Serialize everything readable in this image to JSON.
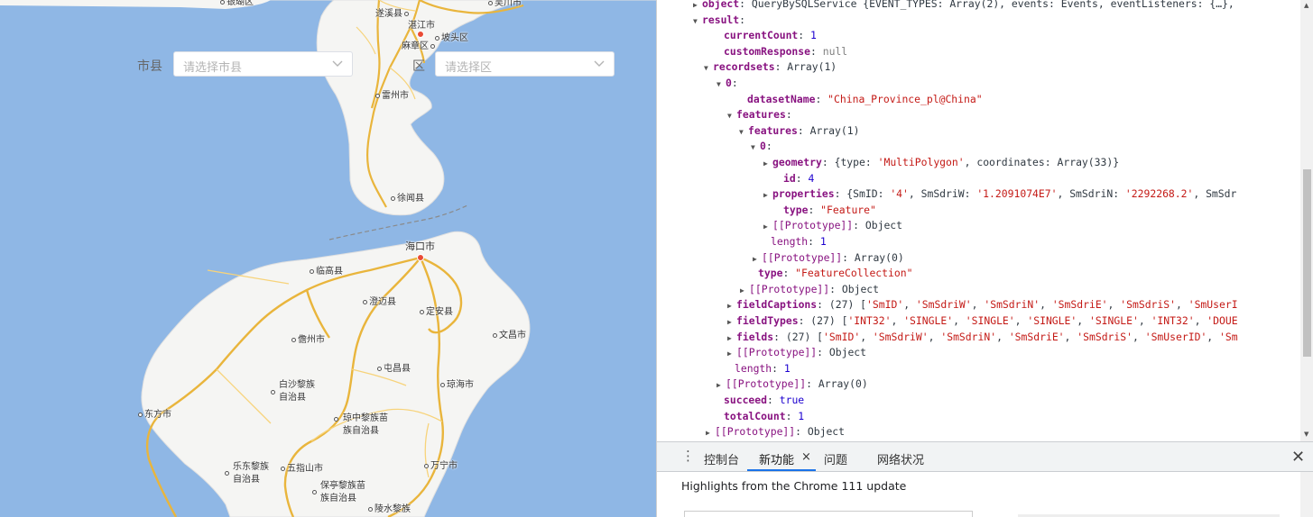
{
  "map": {
    "filters": {
      "city_label": "市县",
      "city_placeholder": "请选择市县",
      "district_label": "区",
      "district_placeholder": "请选择区"
    },
    "places": {
      "yinmu": "银瑚区",
      "suixi": "遂溪县",
      "wuchuan": "吴川市",
      "zhanjiang": "湛江市",
      "mazhang": "麻章区",
      "potou": "坡头区",
      "leizhou": "雷州市",
      "xuwen": "徐闻县",
      "haikou": "海口市",
      "lingao": "临高县",
      "chengmai": "澄迈县",
      "dingan": "定安县",
      "wenchang": "文昌市",
      "danzhou": "儋州市",
      "tunchang": "屯昌县",
      "baisha1": "白沙黎族",
      "baisha2": "自治县",
      "qionghai": "琼海市",
      "dongfang": "东方市",
      "qiongzhong1": "琼中黎族苗",
      "qiongzhong2": "族自治县",
      "ledong1": "乐东黎族",
      "ledong2": "自治县",
      "wuzhishan": "五指山市",
      "wanning": "万宁市",
      "baoting1": "保亭黎族苗",
      "baoting2": "族自治县",
      "lingshui": "陵水黎族"
    }
  },
  "console": {
    "lines": [
      {
        "tw": "▶",
        "parts": [
          [
            "k",
            "object"
          ],
          [
            "pl",
            ": QueryBySQLService {EVENT_TYPES: Array(2), events: Events, eventListeners: {…},"
          ]
        ]
      },
      {
        "tw": "▼",
        "parts": [
          [
            "k",
            "result"
          ],
          [
            "pl",
            ":"
          ]
        ]
      },
      {
        "tw": "",
        "parts": [
          [
            "k",
            "currentCount"
          ],
          [
            "pl",
            ": "
          ],
          [
            "n",
            "1"
          ]
        ]
      },
      {
        "tw": "",
        "parts": [
          [
            "k",
            "customResponse"
          ],
          [
            "pl",
            ": "
          ],
          [
            "nul",
            "null"
          ]
        ]
      },
      {
        "tw": "▼",
        "parts": [
          [
            "k",
            "recordsets"
          ],
          [
            "pl",
            ": Array(1)"
          ]
        ]
      },
      {
        "tw": "▼",
        "parts": [
          [
            "k",
            "0"
          ],
          [
            "pl",
            ":"
          ]
        ]
      },
      {
        "tw": "",
        "parts": [
          [
            "k",
            "datasetName"
          ],
          [
            "pl",
            ": "
          ],
          [
            "s",
            "\"China_Province_pl@China\""
          ]
        ]
      },
      {
        "tw": "▼",
        "parts": [
          [
            "k",
            "features"
          ],
          [
            "pl",
            ":"
          ]
        ]
      },
      {
        "tw": "▼",
        "parts": [
          [
            "k",
            "features"
          ],
          [
            "pl",
            ": Array(1)"
          ]
        ]
      },
      {
        "tw": "▼",
        "parts": [
          [
            "k",
            "0"
          ],
          [
            "pl",
            ":"
          ]
        ]
      },
      {
        "tw": "▶",
        "parts": [
          [
            "k",
            "geometry"
          ],
          [
            "pl",
            ": {type: "
          ],
          [
            "s",
            "'MultiPolygon'"
          ],
          [
            "pl",
            ", coordinates: Array(33)}"
          ]
        ]
      },
      {
        "tw": "",
        "parts": [
          [
            "k",
            "id"
          ],
          [
            "pl",
            ": "
          ],
          [
            "n",
            "4"
          ]
        ]
      },
      {
        "tw": "▶",
        "parts": [
          [
            "k",
            "properties"
          ],
          [
            "pl",
            ": {SmID: "
          ],
          [
            "s",
            "'4'"
          ],
          [
            "pl",
            ", SmSdriW: "
          ],
          [
            "s",
            "'1.2091074E7'"
          ],
          [
            "pl",
            ", SmSdriN: "
          ],
          [
            "s",
            "'2292268.2'"
          ],
          [
            "pl",
            ", SmSdr"
          ]
        ]
      },
      {
        "tw": "",
        "parts": [
          [
            "k",
            "type"
          ],
          [
            "pl",
            ": "
          ],
          [
            "s",
            "\"Feature\""
          ]
        ]
      },
      {
        "tw": "▶",
        "parts": [
          [
            "k2",
            "[[Prototype]]"
          ],
          [
            "pl",
            ": Object"
          ]
        ]
      },
      {
        "tw": "",
        "parts": [
          [
            "k2",
            "length"
          ],
          [
            "pl",
            ": "
          ],
          [
            "n",
            "1"
          ]
        ]
      },
      {
        "tw": "▶",
        "parts": [
          [
            "k2",
            "[[Prototype]]"
          ],
          [
            "pl",
            ": Array(0)"
          ]
        ]
      },
      {
        "tw": "",
        "parts": [
          [
            "k",
            "type"
          ],
          [
            "pl",
            ": "
          ],
          [
            "s",
            "\"FeatureCollection\""
          ]
        ]
      },
      {
        "tw": "▶",
        "parts": [
          [
            "k2",
            "[[Prototype]]"
          ],
          [
            "pl",
            ": Object"
          ]
        ]
      },
      {
        "tw": "▶",
        "parts": [
          [
            "k",
            "fieldCaptions"
          ],
          [
            "pl",
            ": (27) ["
          ],
          [
            "s",
            "'SmID'"
          ],
          [
            "pl",
            ", "
          ],
          [
            "s",
            "'SmSdriW'"
          ],
          [
            "pl",
            ", "
          ],
          [
            "s",
            "'SmSdriN'"
          ],
          [
            "pl",
            ", "
          ],
          [
            "s",
            "'SmSdriE'"
          ],
          [
            "pl",
            ", "
          ],
          [
            "s",
            "'SmSdriS'"
          ],
          [
            "pl",
            ", "
          ],
          [
            "s",
            "'SmUserI"
          ]
        ]
      },
      {
        "tw": "▶",
        "parts": [
          [
            "k",
            "fieldTypes"
          ],
          [
            "pl",
            ": (27) ["
          ],
          [
            "s",
            "'INT32'"
          ],
          [
            "pl",
            ", "
          ],
          [
            "s",
            "'SINGLE'"
          ],
          [
            "pl",
            ", "
          ],
          [
            "s",
            "'SINGLE'"
          ],
          [
            "pl",
            ", "
          ],
          [
            "s",
            "'SINGLE'"
          ],
          [
            "pl",
            ", "
          ],
          [
            "s",
            "'SINGLE'"
          ],
          [
            "pl",
            ", "
          ],
          [
            "s",
            "'INT32'"
          ],
          [
            "pl",
            ", "
          ],
          [
            "s",
            "'DOUE"
          ]
        ]
      },
      {
        "tw": "▶",
        "parts": [
          [
            "k",
            "fields"
          ],
          [
            "pl",
            ": (27) ["
          ],
          [
            "s",
            "'SmID'"
          ],
          [
            "pl",
            ", "
          ],
          [
            "s",
            "'SmSdriW'"
          ],
          [
            "pl",
            ", "
          ],
          [
            "s",
            "'SmSdriN'"
          ],
          [
            "pl",
            ", "
          ],
          [
            "s",
            "'SmSdriE'"
          ],
          [
            "pl",
            ", "
          ],
          [
            "s",
            "'SmSdriS'"
          ],
          [
            "pl",
            ", "
          ],
          [
            "s",
            "'SmUserID'"
          ],
          [
            "pl",
            ", "
          ],
          [
            "s",
            "'Sm"
          ]
        ]
      },
      {
        "tw": "▶",
        "parts": [
          [
            "k2",
            "[[Prototype]]"
          ],
          [
            "pl",
            ": Object"
          ]
        ]
      },
      {
        "tw": "",
        "parts": [
          [
            "k2",
            "length"
          ],
          [
            "pl",
            ": "
          ],
          [
            "n",
            "1"
          ]
        ]
      },
      {
        "tw": "▶",
        "parts": [
          [
            "k2",
            "[[Prototype]]"
          ],
          [
            "pl",
            ": Array(0)"
          ]
        ]
      },
      {
        "tw": "",
        "parts": [
          [
            "k",
            "succeed"
          ],
          [
            "pl",
            ": "
          ],
          [
            "n",
            "true"
          ]
        ]
      },
      {
        "tw": "",
        "parts": [
          [
            "k",
            "totalCount"
          ],
          [
            "pl",
            ": "
          ],
          [
            "n",
            "1"
          ]
        ]
      },
      {
        "tw": "▶",
        "parts": [
          [
            "k2",
            "[[Prototype]]"
          ],
          [
            "pl",
            ": Object"
          ]
        ]
      }
    ]
  },
  "drawer": {
    "tabs": [
      "控制台",
      "新功能",
      "问题",
      "网络状况"
    ],
    "active_tab": "新功能",
    "close_tab_glyph": "×",
    "close_drawer_glyph": "✕",
    "kebab_glyph": "⋮",
    "whats_new": "Highlights from the Chrome 111 update"
  }
}
